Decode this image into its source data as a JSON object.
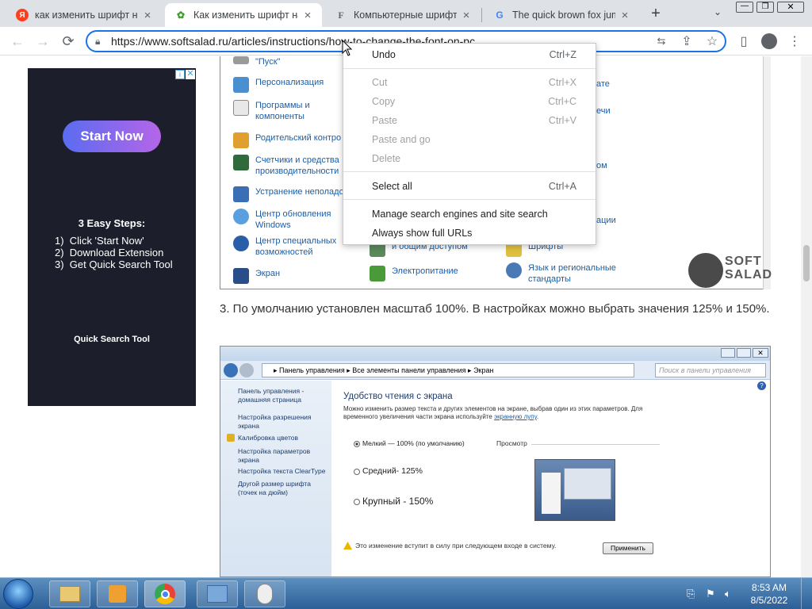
{
  "browser": {
    "tabs": [
      {
        "label": "как изменить шрифт на",
        "icon": "yandex-icon",
        "active": false
      },
      {
        "label": "Как изменить шрифт на",
        "icon": "softsalad-icon",
        "active": true
      },
      {
        "label": "Компьютерные шрифты",
        "icon": "fonts-site-icon",
        "active": false
      },
      {
        "label": "The quick brown fox jump",
        "icon": "google-icon",
        "active": false
      }
    ],
    "url": "https://www.softsalad.ru/articles/instructions/how-to-change-the-font-on-pc"
  },
  "context_menu": {
    "items": [
      {
        "label": "Undo",
        "shortcut": "Ctrl+Z",
        "disabled": false
      },
      {
        "label": "Cut",
        "shortcut": "Ctrl+X",
        "disabled": true
      },
      {
        "label": "Copy",
        "shortcut": "Ctrl+C",
        "disabled": true
      },
      {
        "label": "Paste",
        "shortcut": "Ctrl+V",
        "disabled": true
      },
      {
        "label": "Paste and go",
        "shortcut": "",
        "disabled": true
      },
      {
        "label": "Delete",
        "shortcut": "",
        "disabled": true
      },
      {
        "label": "Select all",
        "shortcut": "Ctrl+A",
        "disabled": false
      },
      {
        "label": "Manage search engines and site search",
        "shortcut": "",
        "disabled": false
      },
      {
        "label": "Always show full URLs",
        "shortcut": "",
        "disabled": false
      }
    ]
  },
  "ad": {
    "button": "Start Now",
    "heading": "3 Easy Steps:",
    "steps": [
      "1)  Click 'Start Now'",
      "2)  Download Extension",
      "3)  Get Quick Search Tool"
    ],
    "footer": "Quick Search Tool"
  },
  "control_panel": {
    "items_col1": [
      "\"Пуск\"",
      "Персонализация",
      "Программы и компоненты",
      "Родительский контро",
      "Счетчики и средства производительности",
      "Устранение неполадо",
      "Центр обновления Windows",
      "Центр специальных возможностей",
      "Экран"
    ],
    "items_col2": [
      "и общим доступом",
      "Электропитание"
    ],
    "items_col3": [
      "ате",
      "ечи",
      "ом",
      "ации",
      "Шрифты",
      "Язык и региональные стандарты"
    ],
    "watermark_top": "SOFT",
    "watermark_bottom": "SALAD"
  },
  "article": {
    "paragraph": "3. По умолчанию установлен масштаб 100%. В настройках можно выбрать значения 125% и 150%."
  },
  "display_panel": {
    "breadcrumb": "▸ Панель управления ▸ Все элементы панели управления ▸ Экран",
    "search_placeholder": "Поиск в панели управления",
    "sidebar": [
      "Панель управления - домашняя страница",
      "Настройка разрешения экрана",
      "Калибровка цветов",
      "Настройка параметров экрана",
      "Настройка текста ClearType",
      "Другой размер шрифта (точек на дюйм)"
    ],
    "title": "Удобство чтения с экрана",
    "desc": "Можно изменить размер текста и других элементов на экране, выбрав один из этих параметров. Для временного увеличения части экрана используйте",
    "desc_link": "экранную лупу",
    "options": [
      "Мелкий — 100% (по умолчанию)",
      "Средний- 125%",
      "Крупный - 150%"
    ],
    "preview_label": "Просмотр",
    "warning": "Это изменение вступит в силу при следующем входе в систему.",
    "apply": "Применить"
  },
  "taskbar": {
    "time": "8:53 AM",
    "date": "8/5/2022"
  },
  "colors": {
    "accent": "#1a73e8",
    "tabstrip": "#dee1e6",
    "taskbar": "#3a6ea5",
    "ad_bg": "#1c1f2b"
  }
}
